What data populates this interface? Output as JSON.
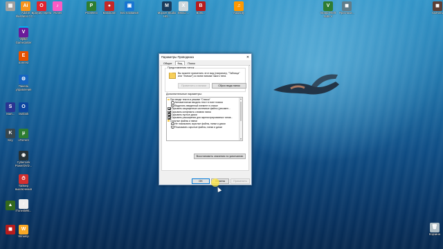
{
  "desktop_icons": [
    {
      "label": "",
      "color": "#a0a0a0",
      "glyph": "▦"
    },
    {
      "label": "Adobe Illustrator CC...",
      "color": "#f7941e",
      "glyph": "Ai"
    },
    {
      "label": "Браузер Opera",
      "color": "#e0242f",
      "glyph": "O"
    },
    {
      "label": "iTunes",
      "color": "#fb5bc5",
      "glyph": "♪"
    },
    {
      "label": "PicSelect",
      "color": "#2e7d32",
      "glyph": "P"
    },
    {
      "label": "Bandicam",
      "color": "#c62828",
      "glyph": "●"
    },
    {
      "label": "Без названия",
      "color": "#1976d2",
      "glyph": "▣"
    },
    {
      "label": "Skype",
      "color": "#00aff0",
      "glyph": "S"
    },
    {
      "label": "Mojave Studio HD...",
      "color": "#1a3b5c",
      "glyph": "M"
    },
    {
      "label": "XMind ...",
      "color": "#cfd8dc",
      "glyph": "X"
    },
    {
      "label": "Boss...",
      "color": "#b71c1c",
      "glyph": "B"
    },
    {
      "label": "Audacity",
      "color": "#ff9800",
      "glyph": "♫"
    },
    {
      "label": "Grand Theft Auto V",
      "color": "#2e7d32",
      "glyph": "V"
    },
    {
      "label": "Пригласи...",
      "color": "#607d8b",
      "glyph": "◼"
    },
    {
      "label": "Скачать",
      "color": "#5d4037",
      "glyph": "◼"
    },
    {
      "label": "Vipsie Gamecaster",
      "color": "#6a1b9a",
      "glyph": "V"
    },
    {
      "label": "Everest",
      "color": "#e65100",
      "glyph": "E"
    },
    {
      "label": "Панель управления",
      "color": "#1565c0",
      "glyph": "⚙"
    },
    {
      "label": "Start...",
      "color": "#283593",
      "glyph": "S"
    },
    {
      "label": "Outlook",
      "color": "#0d47a1",
      "glyph": "O"
    },
    {
      "label": "uTorrent",
      "color": "#2e7d32",
      "glyph": "µ"
    },
    {
      "label": "Key",
      "color": "#37474f",
      "glyph": "K"
    },
    {
      "label": "CyberLink PowerDVD...",
      "color": "#263238",
      "glyph": "◉"
    },
    {
      "label": "Таймер выключения",
      "color": "#d32f2f",
      "glyph": "⏱"
    },
    {
      "label": "",
      "color": "#33691e",
      "glyph": "▲"
    },
    {
      "label": "iTunesMM...",
      "color": "#eeeeee",
      "glyph": "♪"
    },
    {
      "label": "",
      "color": "#b71c1c",
      "glyph": "◼"
    },
    {
      "label": "Winamp",
      "color": "#f9a825",
      "glyph": "W"
    },
    {
      "label": "Корзина",
      "color": "#b0bec5",
      "glyph": "🗑"
    }
  ],
  "dialog": {
    "title": "Параметры Проводника",
    "close_glyph": "✕",
    "tabs": [
      "Общие",
      "Вид",
      "Поиск"
    ],
    "active_tab": 1,
    "folder_view_legend": "Представления папок",
    "folder_view_text": "Вы можете применить этот вид (например, \"Таблица\" или \"Значки\") ко всем папкам такого типа.",
    "apply_to_folders": "Применить к папкам",
    "reset_views": "Сброс вида папок",
    "advanced_label": "Дополнительные параметры:",
    "tree": [
      {
        "type": "folder",
        "indent": 0,
        "text": "При вводе текста в режиме \"Список\""
      },
      {
        "type": "radio",
        "indent": 1,
        "checked": false,
        "text": "Автоматически вводить текст в поле поиска"
      },
      {
        "type": "radio",
        "indent": 1,
        "checked": true,
        "text": "Выделять введенный элемент в списке"
      },
      {
        "type": "check",
        "indent": 0,
        "checked": true,
        "text": "Скрывать защищенные системные файлы (рекомен..."
      },
      {
        "type": "check",
        "indent": 0,
        "checked": true,
        "text": "Скрывать конфликты слияния папок"
      },
      {
        "type": "check",
        "indent": 0,
        "checked": true,
        "text": "Скрывать пустые диски"
      },
      {
        "type": "check",
        "indent": 0,
        "checked": true,
        "text": "Скрывать расширения для зарегистрированных типов..."
      },
      {
        "type": "folder",
        "indent": 0,
        "text": "Скрытые файлы и папки"
      },
      {
        "type": "radio",
        "indent": 1,
        "checked": false,
        "text": "Не показывать скрытые файлы, папки и диски"
      },
      {
        "type": "radio",
        "indent": 1,
        "checked": true,
        "text": "Показывать скрытые файлы, папки и диски"
      }
    ],
    "restore_defaults": "Восстановить значения по умолчанию",
    "ok": "OK",
    "cancel": "Отмена",
    "apply": "Применить"
  }
}
